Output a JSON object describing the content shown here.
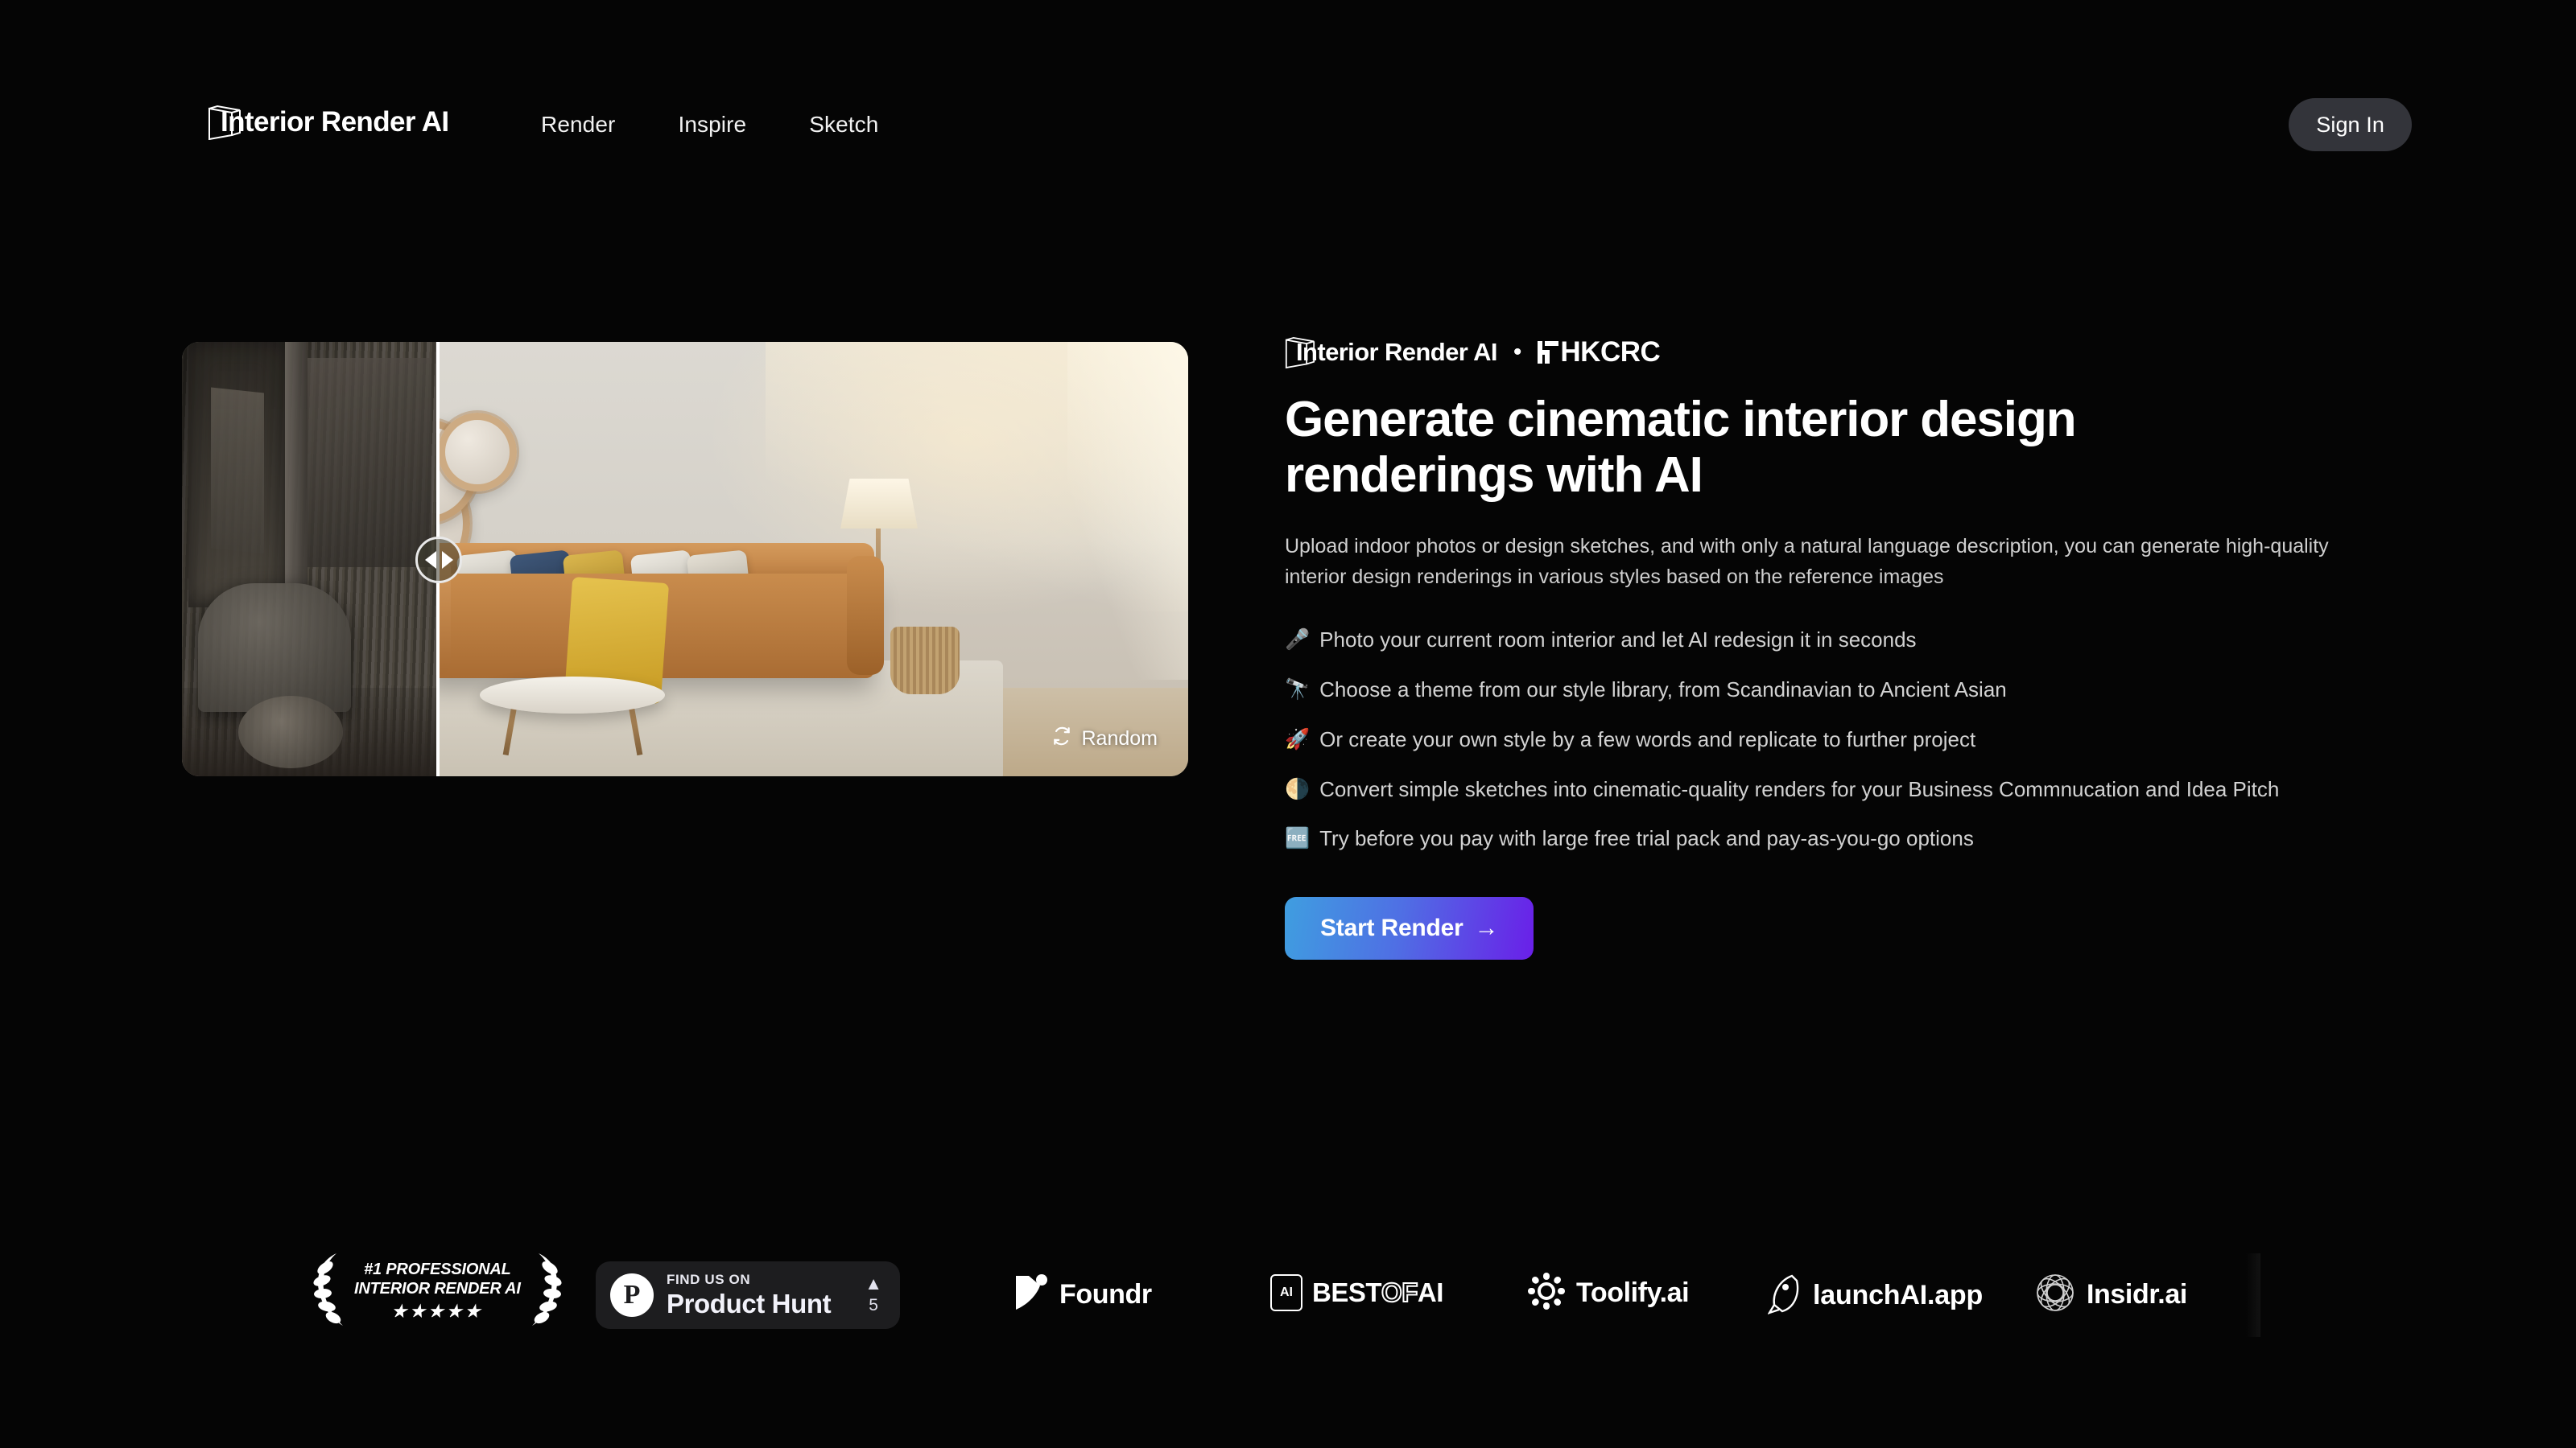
{
  "header": {
    "brand_name": "Interior Render AI",
    "brand_icon": "cube-outline-icon",
    "nav": [
      {
        "label": "Render"
      },
      {
        "label": "Inspire"
      },
      {
        "label": "Sketch"
      }
    ],
    "signin_label": "Sign In",
    "signin_bg": "#33343a"
  },
  "hero": {
    "compare": {
      "handle_icon": "left-right-arrows-icon",
      "random_label": "Random",
      "random_icon": "refresh-cycle-icon",
      "before_alt": "ruined derelict room before render",
      "after_alt": "bright modern living room after AI render"
    },
    "eyebrow": {
      "brand_name": "Interior Render AI",
      "brand_icon": "cube-outline-icon",
      "separator": "•",
      "partner_name": "HKCRC"
    },
    "title": "Generate cinematic interior design renderings with AI",
    "subtitle": "Upload indoor photos or design sketches, and with only a natural language description, you can generate high-quality interior design renderings in various styles based on the reference images",
    "features": [
      {
        "emoji": "🎤",
        "icon_name": "microphone-emoji",
        "text": "Photo your current room interior and let AI redesign it in seconds"
      },
      {
        "emoji": "🔭",
        "icon_name": "telescope-emoji",
        "text": "Choose a theme from our style library, from Scandinavian to Ancient Asian"
      },
      {
        "emoji": "🚀",
        "icon_name": "rocket-emoji",
        "text": "Or create your own style by a few words and replicate to further project"
      },
      {
        "emoji": "🌗",
        "icon_name": "waning-gibbous-moon-emoji",
        "text": "Convert simple sketches into cinematic-quality renders for your Business Commnucation and Idea Pitch"
      },
      {
        "emoji": "🆓",
        "icon_name": "free-button-emoji",
        "text": "Try before you pay with large free trial pack and pay-as-you-go options"
      }
    ],
    "cta": {
      "label": "Start Render",
      "arrow": "→",
      "gradient_from": "#3f9ee0",
      "gradient_to": "#6a1fe8"
    }
  },
  "logobar": {
    "items": [
      {
        "name": "laurel-award",
        "line1": "#1 PROFESSIONAL",
        "line2": "INTERIOR RENDER AI",
        "stars": "★★★★★"
      },
      {
        "name": "product-hunt-badge",
        "kicker": "FIND US ON",
        "title": "Product Hunt",
        "vote_arrow": "▲",
        "vote_count": "5",
        "mark": "P"
      },
      {
        "name": "foundr",
        "title": "Foundr"
      },
      {
        "name": "best-of-ai",
        "badge": "AI",
        "part1": "BEST",
        "part2": "O",
        "part3": "F",
        "part4": "AI"
      },
      {
        "name": "toolify-ai",
        "title": "Toolify.ai"
      },
      {
        "name": "launchai-app",
        "title": "launchAI.app"
      },
      {
        "name": "insidr-ai",
        "title": "Insidr.ai"
      }
    ]
  }
}
